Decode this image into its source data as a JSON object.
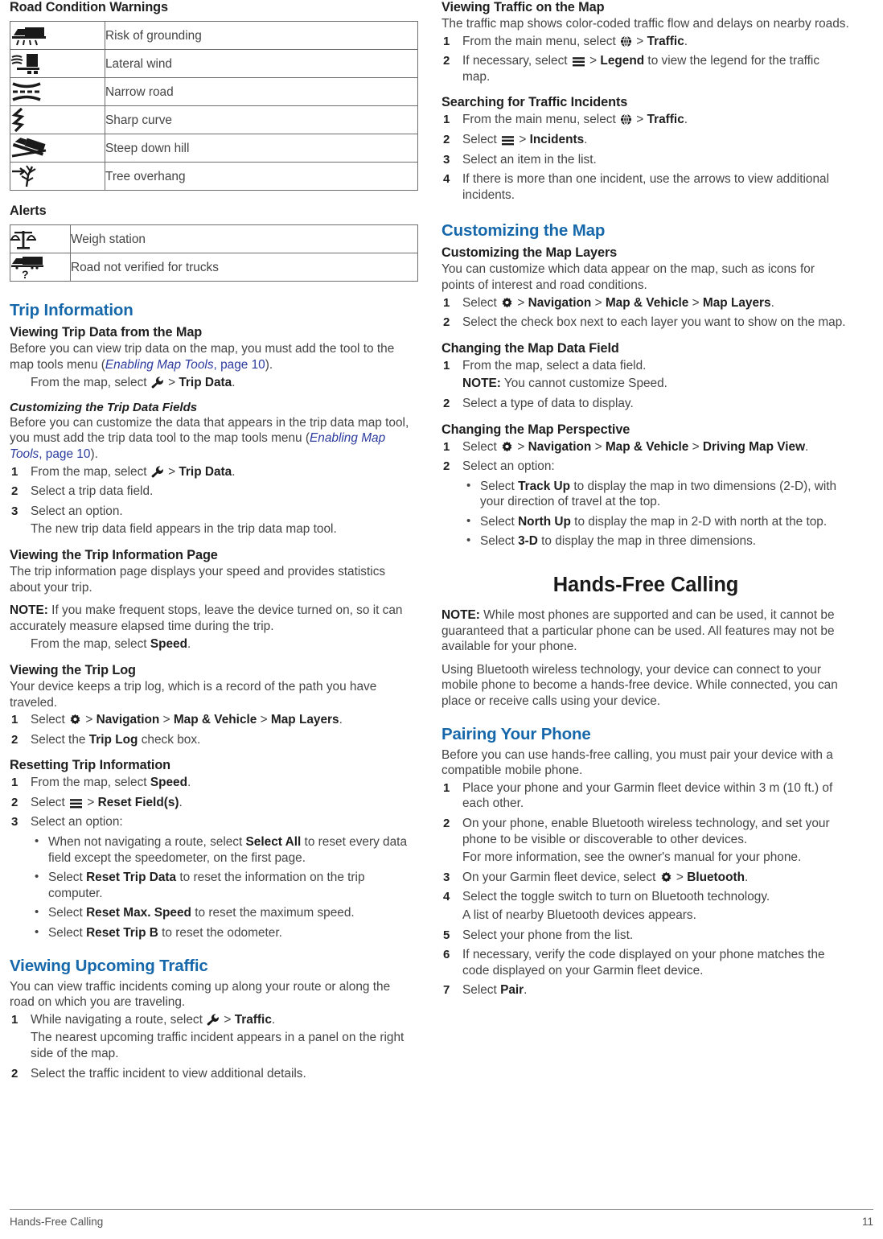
{
  "document": {
    "footer_section": "Hands-Free Calling",
    "page_number": "11",
    "accent_color": "#1668ab",
    "xref_color": "#2b3b9e"
  },
  "left_column": {
    "road_condition_warnings": {
      "heading": "Road Condition Warnings",
      "rows": [
        {
          "icon": "risk-of-grounding-icon",
          "label": "Risk of grounding"
        },
        {
          "icon": "lateral-wind-icon",
          "label": "Lateral wind"
        },
        {
          "icon": "narrow-road-icon",
          "label": "Narrow road"
        },
        {
          "icon": "sharp-curve-icon",
          "label": "Sharp curve"
        },
        {
          "icon": "steep-down-hill-icon",
          "label": "Steep down hill"
        },
        {
          "icon": "tree-overhang-icon",
          "label": "Tree overhang"
        }
      ]
    },
    "alerts": {
      "heading": "Alerts",
      "rows": [
        {
          "icon": "weigh-station-icon",
          "label": "Weigh station"
        },
        {
          "icon": "road-not-verified-icon",
          "label": "Road not verified for trucks"
        }
      ]
    },
    "trip_information": {
      "heading": "Trip Information",
      "viewing_trip_data": {
        "heading": "Viewing Trip Data from the Map",
        "intro_1": "Before you can view trip data on the map, you must add the tool to the map tools menu (",
        "intro_xref": "Enabling Map Tools",
        "intro_2": ", ",
        "intro_page": "page 10",
        "intro_3": ").",
        "action_1": "From the map, select ",
        "action_icon": "wrench-icon",
        "action_2": " > ",
        "action_bold": "Trip Data",
        "action_3": "."
      },
      "customizing_trip_data_fields": {
        "heading": "Customizing the Trip Data Fields",
        "intro_1": "Before you can customize the data that appears in the trip data map tool, you must add the trip data tool to the map tools menu (",
        "intro_xref": "Enabling Map Tools",
        "intro_2": ", ",
        "intro_page": "page 10",
        "intro_3": ").",
        "steps": [
          {
            "num": "1",
            "pre": "From the map, select ",
            "icon": "wrench-icon",
            "mid": " > ",
            "bold": "Trip Data",
            "post": "."
          },
          {
            "num": "2",
            "pre": "Select a trip data field.",
            "icon": "",
            "mid": "",
            "bold": "",
            "post": ""
          },
          {
            "num": "3",
            "pre": "Select an option.",
            "icon": "",
            "mid": "",
            "bold": "",
            "post": ""
          }
        ],
        "result": "The new trip data field appears in the trip data map tool."
      },
      "viewing_trip_info_page": {
        "heading": "Viewing the Trip Information Page",
        "para_1": "The trip information page displays your speed and provides statistics about your trip.",
        "note_label": "NOTE:",
        "note_text": " If you make frequent stops, leave the device turned on, so it can accurately measure elapsed time during the trip.",
        "action_1": "From the map, select ",
        "action_bold": "Speed",
        "action_2": "."
      },
      "viewing_trip_log": {
        "heading": "Viewing the Trip Log",
        "para_1": "Your device keeps a trip log, which is a record of the path you have traveled.",
        "step1_pre": "Select ",
        "step1_icon": "gear-icon",
        "step1_seq": " > ",
        "step1_b1": "Navigation",
        "step1_seq2": " > ",
        "step1_b2": "Map & Vehicle",
        "step1_seq3": " > ",
        "step1_b3": "Map Layers",
        "step1_post": ".",
        "step2_pre": "Select the ",
        "step2_bold": "Trip Log",
        "step2_post": " check box."
      },
      "resetting_trip_information": {
        "heading": "Resetting Trip Information",
        "step1_pre": "From the map, select ",
        "step1_bold": "Speed",
        "step1_post": ".",
        "step2_pre": "Select ",
        "step2_icon": "hamburger-icon",
        "step2_mid": " > ",
        "step2_bold": "Reset Field(s)",
        "step2_post": ".",
        "step3": "Select an option:",
        "bullets": [
          {
            "pre": "When not navigating a route, select ",
            "bold": "Select All",
            "post": " to reset every data field except the speedometer, on the first page."
          },
          {
            "pre": "Select ",
            "bold": "Reset Trip Data",
            "post": " to reset the information on the trip computer."
          },
          {
            "pre": "Select ",
            "bold": "Reset Max. Speed",
            "post": " to reset the maximum speed."
          },
          {
            "pre": "Select ",
            "bold": "Reset Trip B",
            "post": " to reset the odometer."
          }
        ]
      }
    },
    "viewing_upcoming_traffic": {
      "heading": "Viewing Upcoming Traffic",
      "para_1": "You can view traffic incidents coming up along your route or along the road on which you are traveling.",
      "step1_pre": "While navigating a route, select ",
      "step1_icon": "wrench-icon",
      "step1_mid": " > ",
      "step1_bold": "Traffic",
      "step1_post": ".",
      "step1_result": "The nearest upcoming traffic incident appears in a panel on the right side of the map.",
      "step2": "Select the traffic incident to view additional details."
    }
  },
  "right_column": {
    "viewing_traffic_on_map": {
      "heading": "Viewing Traffic on the Map",
      "para_1": "The traffic map shows color-coded traffic flow and delays on nearby roads.",
      "step1_pre": "From the main menu, select ",
      "step1_icon": "apps-globe-icon",
      "step1_mid": " > ",
      "step1_bold": "Traffic",
      "step1_post": ".",
      "step2_pre": "If necessary, select ",
      "step2_icon": "hamburger-icon",
      "step2_mid": " > ",
      "step2_bold": "Legend",
      "step2_post": " to view the legend for the traffic map."
    },
    "searching_traffic_incidents": {
      "heading": "Searching for Traffic Incidents",
      "step1_pre": "From the main menu, select ",
      "step1_icon": "apps-globe-icon",
      "step1_mid": " > ",
      "step1_bold": "Traffic",
      "step1_post": ".",
      "step2_pre": "Select ",
      "step2_icon": "hamburger-icon",
      "step2_mid": " > ",
      "step2_bold": "Incidents",
      "step2_post": ".",
      "step3": "Select an item in the list.",
      "step4": "If there is more than one incident, use the arrows to view additional incidents."
    },
    "customizing_the_map": {
      "heading": "Customizing the Map",
      "customizing_map_layers": {
        "heading": "Customizing the Map Layers",
        "para_1": "You can customize which data appear on the map, such as icons for points of interest and road conditions.",
        "step1_pre": "Select ",
        "step1_icon": "gear-icon",
        "step1_seq": " > ",
        "step1_b1": "Navigation",
        "step1_seq2": " > ",
        "step1_b2": "Map & Vehicle",
        "step1_seq3": " > ",
        "step1_b3": "Map Layers",
        "step1_post": ".",
        "step2": "Select the check box next to each layer you want to show on the map."
      },
      "changing_map_data_field": {
        "heading": "Changing the Map Data Field",
        "step1": "From the map, select a data field.",
        "note_label": "NOTE:",
        "note_text": " You cannot customize Speed.",
        "step2": "Select a type of data to display."
      },
      "changing_map_perspective": {
        "heading": "Changing the Map Perspective",
        "step1_pre": "Select ",
        "step1_icon": "gear-icon",
        "step1_seq": " > ",
        "step1_b1": "Navigation",
        "step1_seq2": " > ",
        "step1_b2": "Map & Vehicle",
        "step1_seq3": " > ",
        "step1_b3": "Driving Map View",
        "step1_post": ".",
        "step2": "Select an option:",
        "bullets": [
          {
            "pre": "Select ",
            "bold": "Track Up",
            "post": " to display the map in two dimensions (2-D), with your direction of travel at the top."
          },
          {
            "pre": "Select ",
            "bold": "North Up",
            "post": " to display the map in 2-D with north at the top."
          },
          {
            "pre": "Select ",
            "bold": "3-D",
            "post": " to display the map in three dimensions."
          }
        ]
      }
    },
    "hands_free_calling": {
      "heading": "Hands-Free Calling",
      "note_label": "NOTE:",
      "note_text": " While most phones are supported and can be used, it cannot be guaranteed that a particular phone can be used. All features may not be available for your phone.",
      "para_1": "Using Bluetooth wireless technology, your device can connect to your mobile phone to become a hands-free device. While connected, you can place or receive calls using your device.",
      "pairing_your_phone": {
        "heading": "Pairing Your Phone",
        "para_1": "Before you can use hands-free calling, you must pair your device with a compatible mobile phone.",
        "step1": "Place your phone and your Garmin fleet device within 3 m (10 ft.) of each other.",
        "step2": "On your phone, enable Bluetooth wireless technology, and set your phone to be visible or discoverable to other devices.",
        "step2_result": "For more information, see the owner's manual for your phone.",
        "step3_pre": "On your Garmin fleet device, select ",
        "step3_icon": "gear-icon",
        "step3_mid": " > ",
        "step3_bold": "Bluetooth",
        "step3_post": ".",
        "step4": "Select the toggle switch to turn on Bluetooth technology.",
        "step4_result": "A list of nearby Bluetooth devices appears.",
        "step5": "Select your phone from the list.",
        "step6": "If necessary, verify the code displayed on your phone matches the code displayed on your Garmin fleet device.",
        "step7_pre": "Select ",
        "step7_bold": "Pair",
        "step7_post": "."
      }
    }
  }
}
